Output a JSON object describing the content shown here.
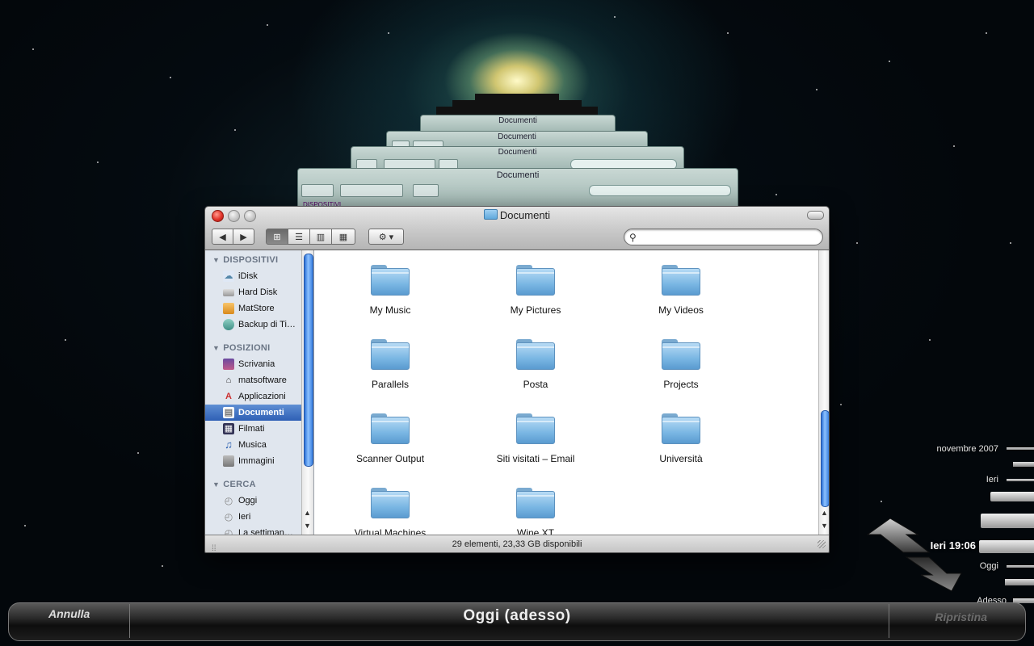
{
  "finder": {
    "title": "Documenti",
    "search_placeholder": "",
    "view_buttons": [
      "icon-view",
      "list-view",
      "column-view",
      "coverflow-view"
    ],
    "sidebar": {
      "sections": [
        {
          "header": "DISPOSITIVI",
          "items": [
            {
              "label": "iDisk",
              "icon": "idisk-icon"
            },
            {
              "label": "Hard Disk",
              "icon": "harddisk-icon"
            },
            {
              "label": "MatStore",
              "icon": "drive-icon"
            },
            {
              "label": "Backup di Ti…",
              "icon": "timemachine-disk-icon"
            }
          ]
        },
        {
          "header": "POSIZIONI",
          "items": [
            {
              "label": "Scrivania",
              "icon": "desktop-icon"
            },
            {
              "label": "matsoftware",
              "icon": "home-icon"
            },
            {
              "label": "Applicazioni",
              "icon": "applications-icon"
            },
            {
              "label": "Documenti",
              "icon": "documents-icon",
              "selected": true
            },
            {
              "label": "Filmati",
              "icon": "movies-icon"
            },
            {
              "label": "Musica",
              "icon": "music-icon"
            },
            {
              "label": "Immagini",
              "icon": "pictures-icon"
            }
          ]
        },
        {
          "header": "CERCA",
          "items": [
            {
              "label": "Oggi",
              "icon": "clock-icon"
            },
            {
              "label": "Ieri",
              "icon": "clock-icon"
            },
            {
              "label": "La settiman…",
              "icon": "clock-icon"
            }
          ]
        }
      ]
    },
    "items": [
      "My Music",
      "My Pictures",
      "My Videos",
      "Parallels",
      "Posta",
      "Projects",
      "Scanner Output",
      "Siti visitati – Email",
      "Università",
      "Virtual Machines",
      "Wine XT"
    ],
    "status": "29 elementi, 23,33 GB disponibili"
  },
  "ghost_windows": {
    "title": "Documenti",
    "sidebar_header": "DISPOSITIVI"
  },
  "timeline": {
    "labels": [
      "novembre 2007",
      "Ieri",
      "Ieri 19:06",
      "Oggi",
      "Adesso"
    ]
  },
  "bottom_bar": {
    "cancel": "Annulla",
    "title": "Oggi (adesso)",
    "restore": "Ripristina"
  },
  "colors": {
    "selection": "#2e5fb5",
    "scroll_thumb": "#3a80e0",
    "folder": "#79b6e3"
  }
}
